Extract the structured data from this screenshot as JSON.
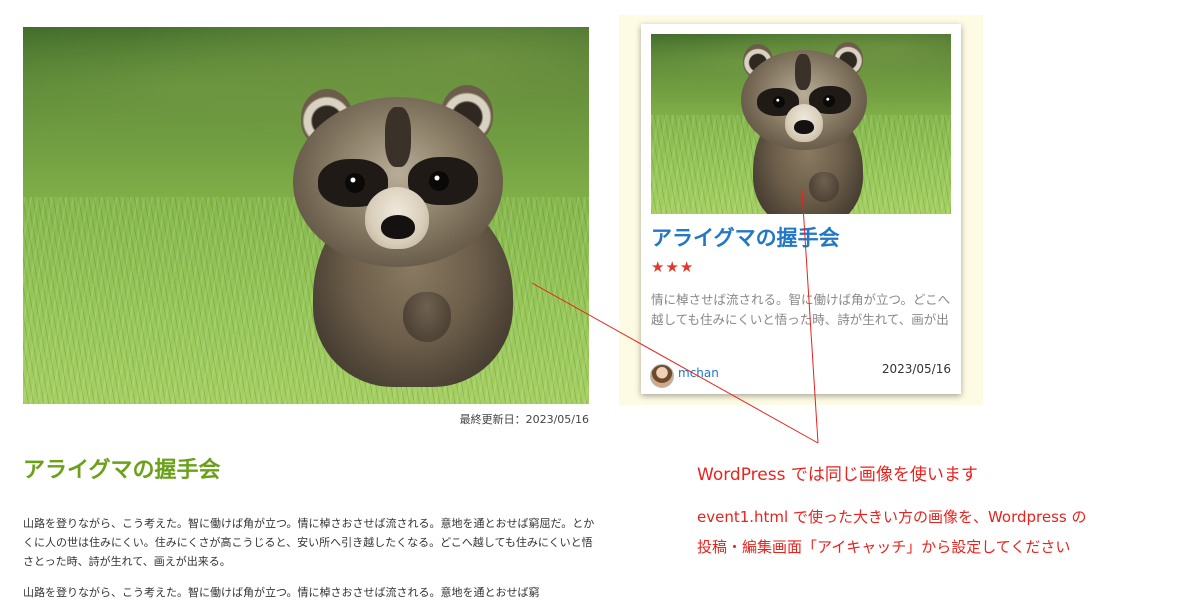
{
  "article": {
    "updated_label": "最終更新日：2023/05/16",
    "title": "アライグマの握手会",
    "paragraphs": [
      "山路を登りながら、こう考えた。智に働けば角が立つ。情に棹さおさせば流される。意地を通とおせば窮屈だ。とかくに人の世は住みにくい。住みにくさが高こうじると、安い所へ引き越したくなる。どこへ越しても住みにくいと悟さとった時、詩が生れて、画えが出来る。",
      "山路を登りながら、こう考えた。智に働けば角が立つ。情に棹さおさせば流される。意地を通とおせば窮"
    ]
  },
  "card": {
    "title": "アライグマの握手会",
    "stars": "★★★",
    "excerpt": "情に棹させば流される。智に働けば角が立つ。どこへ越しても住みにくいと悟った時、詩が生れて、画が出",
    "author": "mchan",
    "date": "2023/05/16"
  },
  "note": {
    "heading": "WordPress では同じ画像を使います",
    "line1": "event1.html で使った大きい方の画像を、Wordpress の",
    "line2": "投稿・編集画面「アイキャッチ」から設定してください"
  },
  "colors": {
    "article_title": "#6aa119",
    "card_title": "#2277c6",
    "stars": "#e03a2e",
    "annotation": "#e8231e",
    "card_panel_bg": "#fefbe4"
  }
}
